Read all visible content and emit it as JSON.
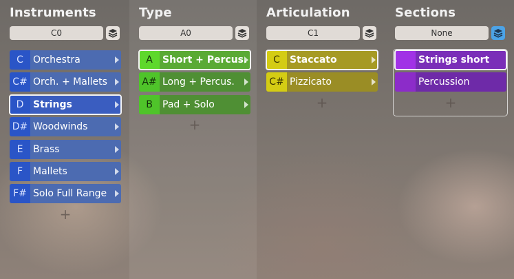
{
  "columns": [
    {
      "id": "instruments",
      "title": "Instruments",
      "selector_value": "C0",
      "layer_icon": "layers-icon",
      "items": [
        {
          "key": "C",
          "label": "Orchestra",
          "selected": false
        },
        {
          "key": "C#",
          "label": "Orch. + Mallets",
          "selected": false
        },
        {
          "key": "D",
          "label": "Strings",
          "selected": true
        },
        {
          "key": "D#",
          "label": "Woodwinds",
          "selected": false
        },
        {
          "key": "E",
          "label": "Brass",
          "selected": false
        },
        {
          "key": "F",
          "label": "Mallets",
          "selected": false
        },
        {
          "key": "F#",
          "label": "Solo Full Range",
          "selected": false
        }
      ],
      "add_label": "+"
    },
    {
      "id": "type",
      "title": "Type",
      "selector_value": "A0",
      "layer_icon": "layers-icon",
      "items": [
        {
          "key": "A",
          "label": "Short + Percus.",
          "selected": true
        },
        {
          "key": "A#",
          "label": "Long + Percus.",
          "selected": false
        },
        {
          "key": "B",
          "label": "Pad + Solo",
          "selected": false
        }
      ],
      "add_label": "+"
    },
    {
      "id": "articulation",
      "title": "Articulation",
      "selector_value": "C1",
      "layer_icon": "layers-icon",
      "items": [
        {
          "key": "C",
          "label": "Staccato",
          "selected": true
        },
        {
          "key": "C#",
          "label": "Pizzicato",
          "selected": false
        }
      ],
      "add_label": "+"
    },
    {
      "id": "sections",
      "title": "Sections",
      "selector_value": "None",
      "layer_icon": "layers-icon",
      "layer_active": true,
      "items": [
        {
          "key": "",
          "label": "Strings short",
          "selected": true
        },
        {
          "key": "",
          "label": "Percussion",
          "selected": false
        }
      ],
      "add_label": "+"
    }
  ],
  "colors": {
    "instruments": "#2a55c7",
    "type": "#4fc42a",
    "articulation": "#d4cc14",
    "sections": "#8c2cc9",
    "layer_active": "#4ca3e6"
  }
}
